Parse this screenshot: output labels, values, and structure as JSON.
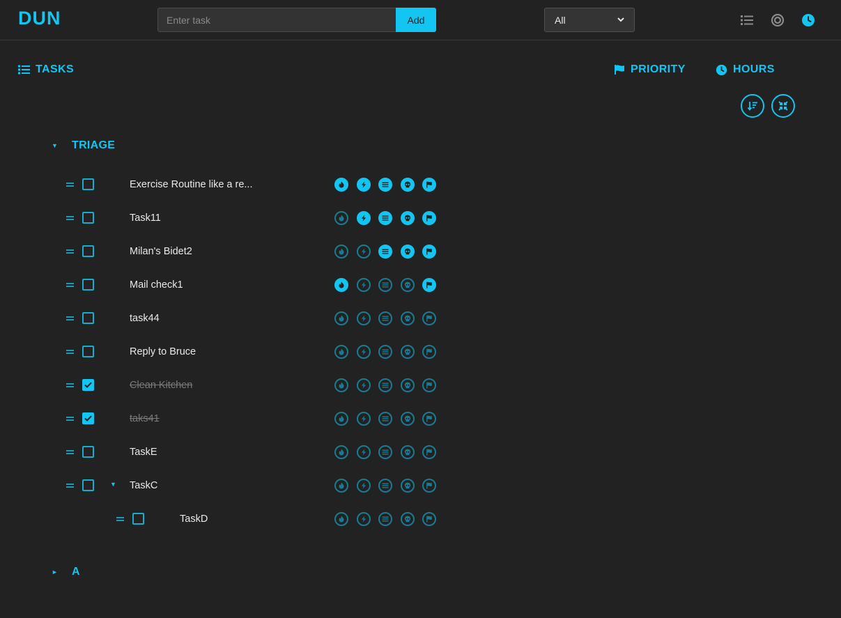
{
  "header": {
    "brand": "DUN",
    "task_placeholder": "Enter task",
    "add_label": "Add",
    "filter_value": "All"
  },
  "columns": {
    "tasks": "TASKS",
    "priority": "PRIORITY",
    "hours": "HOURS"
  },
  "colors": {
    "accent": "#13c5f1",
    "background": "#222222"
  },
  "groups": [
    {
      "name": "TRIAGE",
      "expanded": true,
      "tasks": [
        {
          "name": "Exercise Routine like a re...",
          "done": false,
          "indent": 0,
          "flags": [
            true,
            true,
            true,
            true,
            true
          ]
        },
        {
          "name": "Task11",
          "done": false,
          "indent": 0,
          "flags": [
            false,
            true,
            true,
            true,
            true
          ]
        },
        {
          "name": "Milan's Bidet2",
          "done": false,
          "indent": 0,
          "flags": [
            false,
            false,
            true,
            true,
            true
          ]
        },
        {
          "name": "Mail check1",
          "done": false,
          "indent": 0,
          "flags": [
            true,
            false,
            false,
            false,
            true
          ]
        },
        {
          "name": "task44",
          "done": false,
          "indent": 0,
          "flags": [
            false,
            false,
            false,
            false,
            false
          ]
        },
        {
          "name": "Reply to Bruce",
          "done": false,
          "indent": 0,
          "flags": [
            false,
            false,
            false,
            false,
            false
          ]
        },
        {
          "name": "Clean Kitchen",
          "done": true,
          "indent": 0,
          "flags": [
            false,
            false,
            false,
            false,
            false
          ]
        },
        {
          "name": "taks41",
          "done": true,
          "indent": 0,
          "flags": [
            false,
            false,
            false,
            false,
            false
          ]
        },
        {
          "name": "TaskE",
          "done": false,
          "indent": 0,
          "flags": [
            false,
            false,
            false,
            false,
            false
          ]
        },
        {
          "name": "TaskC",
          "done": false,
          "indent": 0,
          "has_children": true,
          "flags": [
            false,
            false,
            false,
            false,
            false
          ]
        },
        {
          "name": "TaskD",
          "done": false,
          "indent": 1,
          "flags": [
            false,
            false,
            false,
            false,
            false
          ]
        }
      ]
    },
    {
      "name": "A",
      "expanded": false,
      "tasks": []
    }
  ],
  "flag_icons": [
    "fire-icon",
    "bolt-icon",
    "lines-icon",
    "skull-icon",
    "flag-icon"
  ]
}
